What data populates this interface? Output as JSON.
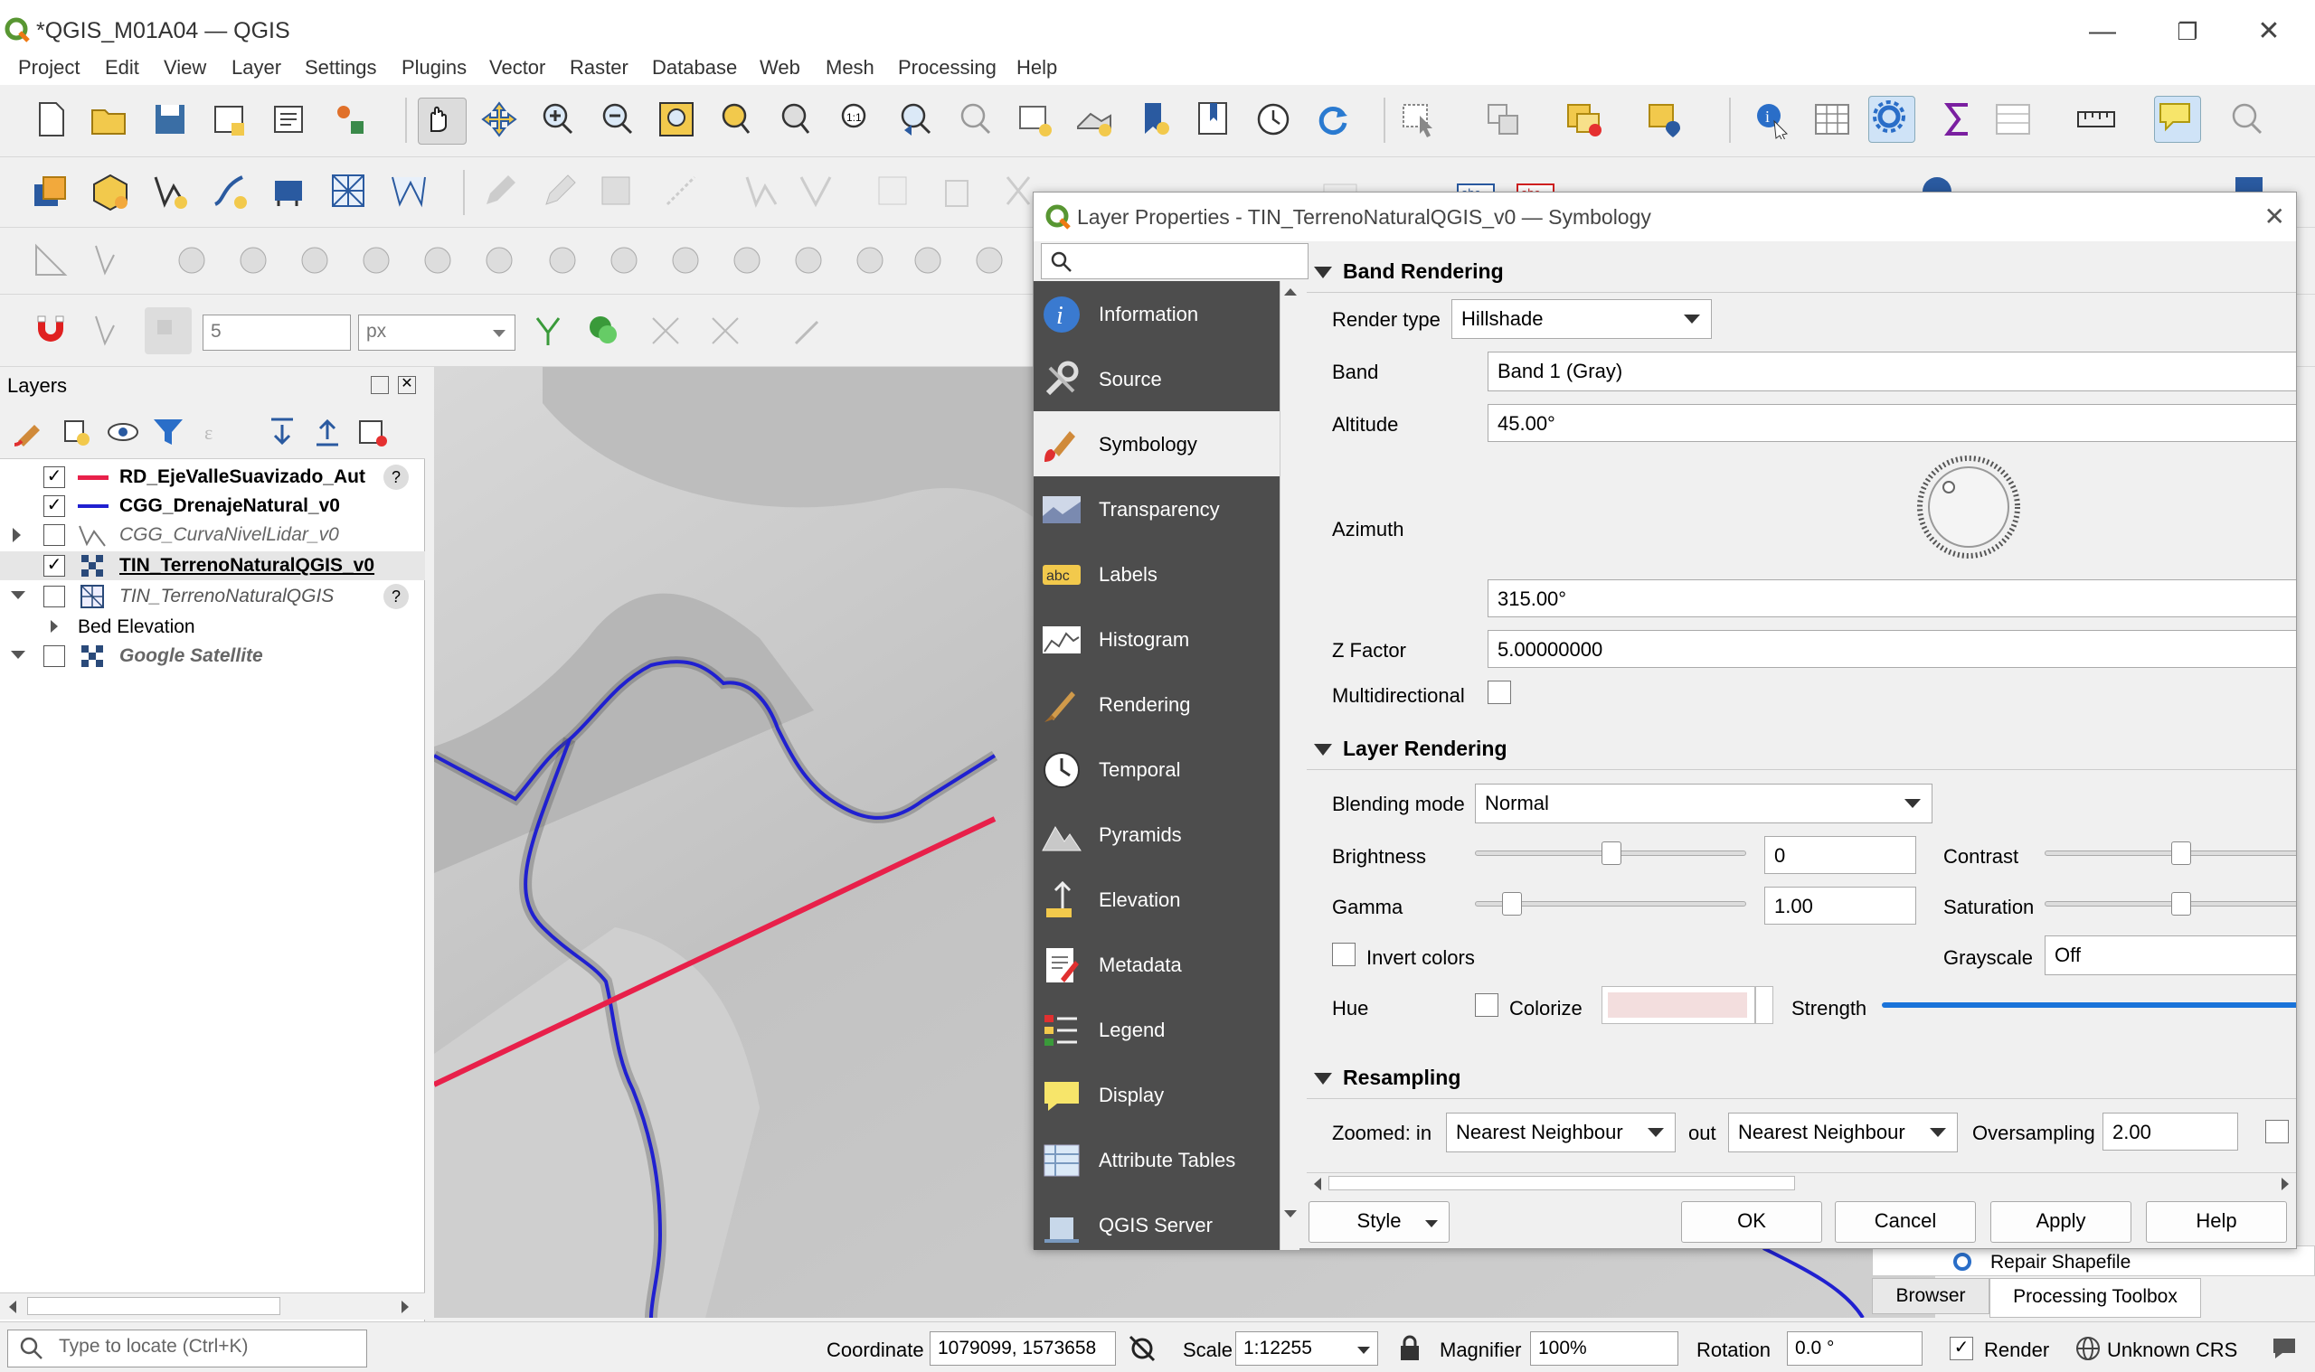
{
  "window": {
    "title": "*QGIS_M01A04 — QGIS",
    "minimize": "—",
    "restore": "❐",
    "close": "✕"
  },
  "menu": [
    "Project",
    "Edit",
    "View",
    "Layer",
    "Settings",
    "Plugins",
    "Vector",
    "Raster",
    "Database",
    "Web",
    "Mesh",
    "Processing",
    "Help"
  ],
  "snapping": {
    "tolerance": "5",
    "units": "px"
  },
  "layers_panel": {
    "title": "Layers",
    "items": [
      {
        "name": "RD_EjeValleSuavizado_Aut",
        "checked": "✓",
        "style": "bold",
        "symbol": "line-red"
      },
      {
        "name": "CGG_DrenajeNatural_v0",
        "checked": "✓",
        "style": "bold",
        "symbol": "line-blue"
      },
      {
        "name": "CGG_CurvaNivelLidar_v0",
        "checked": "",
        "style": "italic",
        "symbol": "line-icon"
      },
      {
        "name": "TIN_TerrenoNaturalQGIS_v0",
        "checked": "✓",
        "style": "bold-underline",
        "symbol": "raster-icon"
      },
      {
        "name": "TIN_TerrenoNaturalQGIS",
        "checked": "",
        "style": "italic",
        "symbol": "mesh-icon"
      },
      {
        "name": "Bed Elevation",
        "checked": "",
        "style": "normal",
        "symbol": ""
      },
      {
        "name": "Google Satellite",
        "checked": "",
        "style": "bold-italic",
        "symbol": "raster-icon"
      }
    ]
  },
  "dialog": {
    "title": "Layer Properties - TIN_TerrenoNaturalQGIS_v0 — Symbology",
    "search_placeholder": "",
    "nav": [
      "Information",
      "Source",
      "Symbology",
      "Transparency",
      "Labels",
      "Histogram",
      "Rendering",
      "Temporal",
      "Pyramids",
      "Elevation",
      "Metadata",
      "Legend",
      "Display",
      "Attribute Tables",
      "QGIS Server"
    ],
    "selected_nav": "Symbology",
    "band_rendering": {
      "section": "Band Rendering",
      "render_type_label": "Render type",
      "render_type": "Hillshade",
      "band_label": "Band",
      "band": "Band 1 (Gray)",
      "altitude_label": "Altitude",
      "altitude": "45.00°",
      "azimuth_label": "Azimuth",
      "azimuth": "315.00°",
      "zfactor_label": "Z Factor",
      "zfactor": "5.00000000",
      "multidirectional_label": "Multidirectional"
    },
    "layer_rendering": {
      "section": "Layer Rendering",
      "blending_label": "Blending mode",
      "blending": "Normal",
      "brightness_label": "Brightness",
      "brightness": "0",
      "contrast_label": "Contrast",
      "gamma_label": "Gamma",
      "gamma": "1.00",
      "saturation_label": "Saturation",
      "invert_label": "Invert colors",
      "grayscale_label": "Grayscale",
      "grayscale": "Off",
      "hue_label": "Hue",
      "colorize_label": "Colorize",
      "strength_label": "Strength"
    },
    "resampling": {
      "section": "Resampling",
      "zoomed_label": "Zoomed: in",
      "zoomed_in": "Nearest Neighbour",
      "out_label": "out",
      "zoomed_out": "Nearest Neighbour",
      "oversampling_label": "Oversampling",
      "oversampling": "2.00"
    },
    "buttons": {
      "style": "Style",
      "ok": "OK",
      "cancel": "Cancel",
      "apply": "Apply",
      "help": "Help"
    }
  },
  "right_dock": {
    "item": "Repair Shapefile",
    "tabs": [
      "Browser",
      "Processing Toolbox"
    ]
  },
  "statusbar": {
    "locate_placeholder": "Type to locate (Ctrl+K)",
    "coordinate_label": "Coordinate",
    "coordinate": "1079099, 1573658",
    "scale_label": "Scale",
    "scale": "1:12255",
    "magnifier_label": "Magnifier",
    "magnifier": "100%",
    "rotation_label": "Rotation",
    "rotation": "0.0 °",
    "render_label": "Render",
    "crs": "Unknown CRS"
  },
  "colors": {
    "accent": "#1a73d9",
    "nav_bg": "#4d4d4d",
    "red_line": "#e8204a",
    "blue_line": "#2020d0"
  }
}
